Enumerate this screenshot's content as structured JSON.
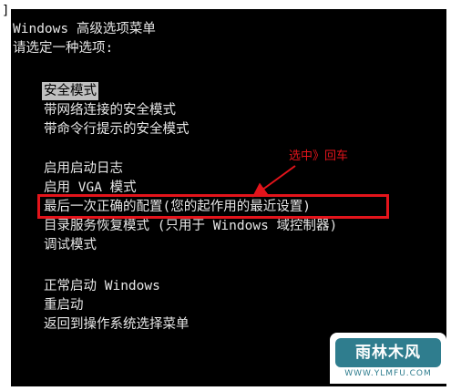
{
  "corner_mark": "]",
  "menu": {
    "title": "Windows 高级选项菜单",
    "prompt": "请选定一种选项:",
    "options": [
      "安全模式",
      "带网络连接的安全模式",
      "带命令行提示的安全模式",
      "启用启动日志",
      "启用 VGA 模式",
      "最后一次正确的配置(您的起作用的最近设置)",
      "目录服务恢复模式 (只用于 Windows 域控制器)",
      "调试模式",
      "正常启动 Windows",
      "重启动",
      "返回到操作系统选择菜单"
    ],
    "selected_option": "安全模式"
  },
  "annotation": {
    "text": "选中》回车",
    "color": "#e3141b"
  },
  "watermark": {
    "brand": "雨林木风",
    "url": "WWW.YLMFU.COM",
    "color": "#2f7d8e"
  },
  "colors": {
    "screen_bg": "#000000",
    "screen_text": "#e6e6e6",
    "highlight_bg": "#c0c0c0",
    "highlight_box": "#e3141b"
  }
}
